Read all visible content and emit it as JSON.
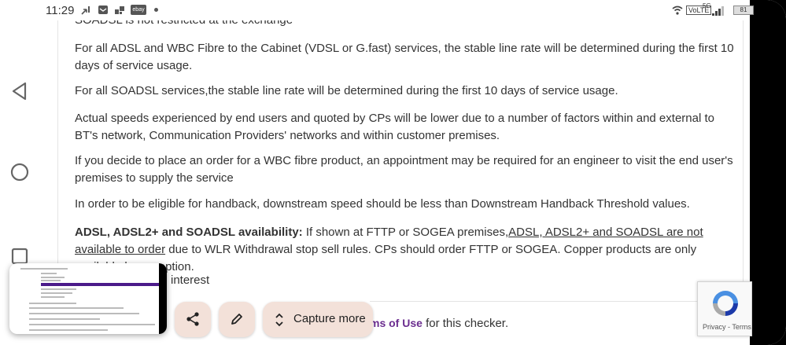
{
  "status_bar": {
    "time": "11:29",
    "ebay_badge": "ebay",
    "volte": "VoLTE",
    "network": "5G",
    "battery": "81"
  },
  "content": {
    "cut_line": "SOADSL is not restricted at the exchange",
    "p1": "For all ADSL and WBC Fibre to the Cabinet (VDSL or G.fast) services, the stable line rate will be determined during the first 10 days of service usage.",
    "p2": "For all SOADSL services,the stable line rate will be determined during the first 10 days of service usage.",
    "p3": "Actual speeds experienced by end users and quoted by CPs will be lower due to a number of factors within and external to BT's network, Communication Providers' networks and within customer premises.",
    "p4": "If you decide to place an order for a WBC fibre product, an appointment may be required for an engineer to visit the end user's premises to supply the service",
    "p5": "In order to be eligible for handback, downstream speed should be less than Downstream Handback Threshold values.",
    "p6_bold": "ADSL, ADSL2+ and SOADSL availability:",
    "p6_text1": " If shown at FTTP or SOGEA premises,",
    "p6_link": "ADSL, ADSL2+ and SOADSL are not available to order",
    "p6_text2": " due to WLR Withdrawal stop sell rules. CPs should order FTTP or SOGEA. Copper products are only available by exception.",
    "p7": "interest",
    "terms_link": "ms of Use",
    "terms_suffix": " for this checker."
  },
  "recaptcha": {
    "privacy_terms": "Privacy - Terms"
  },
  "actions": {
    "capture_label": "Capture more"
  }
}
